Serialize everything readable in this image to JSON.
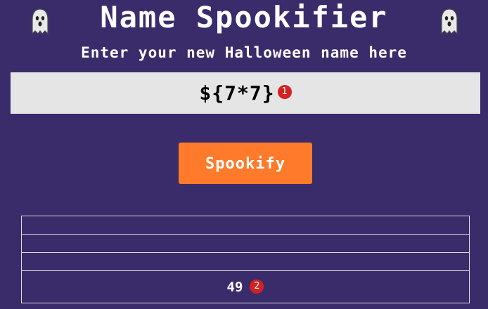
{
  "header": {
    "title": "Name Spookifier",
    "left_icon": "ghost-icon",
    "right_icon": "ghost-icon"
  },
  "form": {
    "prompt": "Enter your new Halloween name here",
    "input_value": "${7*7}",
    "input_marker": "1",
    "button_label": "Spookify"
  },
  "results": {
    "rows": [
      "",
      "",
      "",
      "49"
    ],
    "value_marker": "2"
  },
  "colors": {
    "background": "#3a2c6b",
    "button": "#ff7a2a",
    "input_background": "#e5e5e5",
    "marker": "#d32121"
  }
}
